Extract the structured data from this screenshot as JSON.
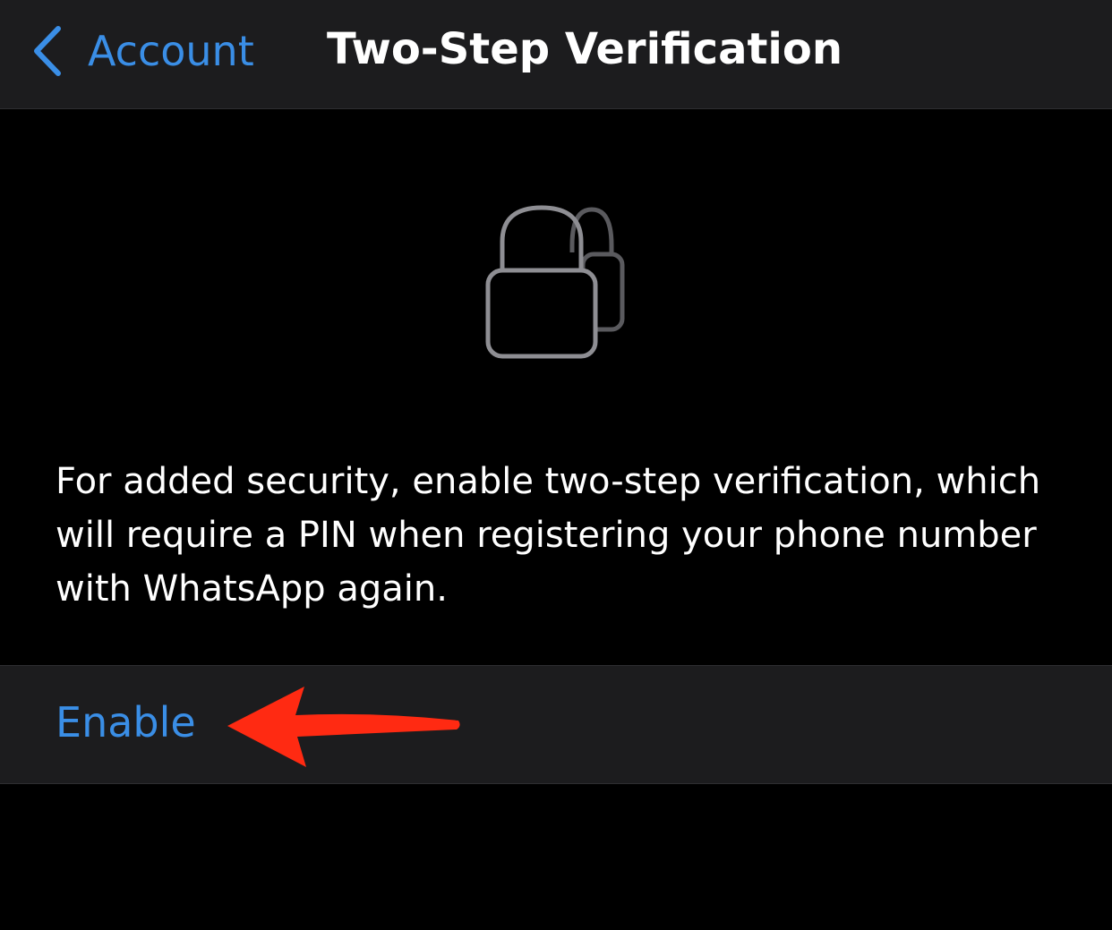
{
  "nav": {
    "back_label": "Account",
    "title": "Two-Step Verification"
  },
  "main": {
    "icon": "lock-icon",
    "description": "For added security, enable two-step verification, which will require a PIN when registering your phone number with WhatsApp again."
  },
  "actions": {
    "enable_label": "Enable"
  },
  "annotation": {
    "icon": "arrow-left-icon",
    "color": "#ff2a12"
  },
  "colors": {
    "accent": "#3a8ee6",
    "background": "#000000",
    "surface": "#1c1c1e",
    "icon_gray": "#8e8e93"
  }
}
